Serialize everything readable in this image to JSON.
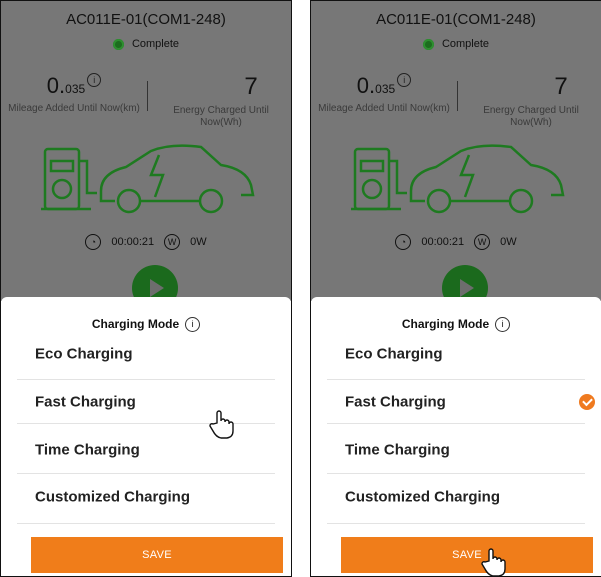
{
  "screens": [
    {
      "device_title": "AC011E-01(COM1-248)",
      "status": "Complete",
      "mileage": {
        "value_main": "0.",
        "value_decimal": "035",
        "label": "Mileage Added Until Now(km)"
      },
      "energy": {
        "value": "7",
        "label": "Energy Charged Until Now(Wh)"
      },
      "timer": "00:00:21",
      "power": "0W",
      "sheet": {
        "title": "Charging Mode",
        "modes": [
          "Eco Charging",
          "Fast Charging",
          "Time Charging",
          "Customized Charging"
        ],
        "selected_index": -1,
        "save_label": "SAVE"
      }
    },
    {
      "device_title": "AC011E-01(COM1-248)",
      "status": "Complete",
      "mileage": {
        "value_main": "0.",
        "value_decimal": "035",
        "label": "Mileage Added Until Now(km)"
      },
      "energy": {
        "value": "7",
        "label": "Energy Charged Until Now(Wh)"
      },
      "timer": "00:00:21",
      "power": "0W",
      "sheet": {
        "title": "Charging Mode",
        "modes": [
          "Eco Charging",
          "Fast Charging",
          "Time Charging",
          "Customized Charging"
        ],
        "selected_index": 1,
        "save_label": "SAVE"
      }
    }
  ],
  "icons": {
    "info": "i",
    "watt": "W",
    "status_color": "#2e8f30",
    "accent": "#f07d1a",
    "car_stroke": "#1e7a20"
  }
}
